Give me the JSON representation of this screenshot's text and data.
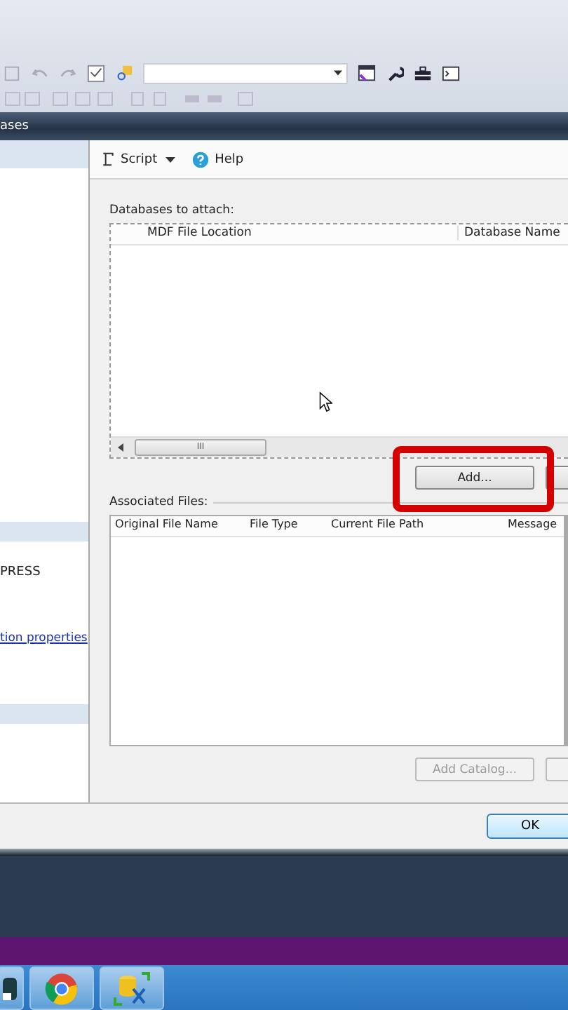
{
  "dialog": {
    "title": "ases",
    "toolbar": [
      {
        "label": "Script",
        "kind": "script"
      },
      {
        "label": "Help",
        "kind": "help"
      }
    ],
    "left_panel": {
      "text": "PRESS",
      "link": "tion properties"
    },
    "databases": {
      "label": "Databases to attach:",
      "columns": [
        "MDF File Location",
        "Database Name"
      ],
      "scroll_grip": "III"
    },
    "add_button": {
      "label": "Add...",
      "highlighted": true
    },
    "associated": {
      "label": "Associated Files:",
      "columns": [
        "Original File Name",
        "File Type",
        "Current File Path",
        "Message"
      ]
    },
    "add_catalog_button": {
      "label": "Add Catalog...",
      "disabled": true
    },
    "ok_button": {
      "label": "OK"
    }
  }
}
